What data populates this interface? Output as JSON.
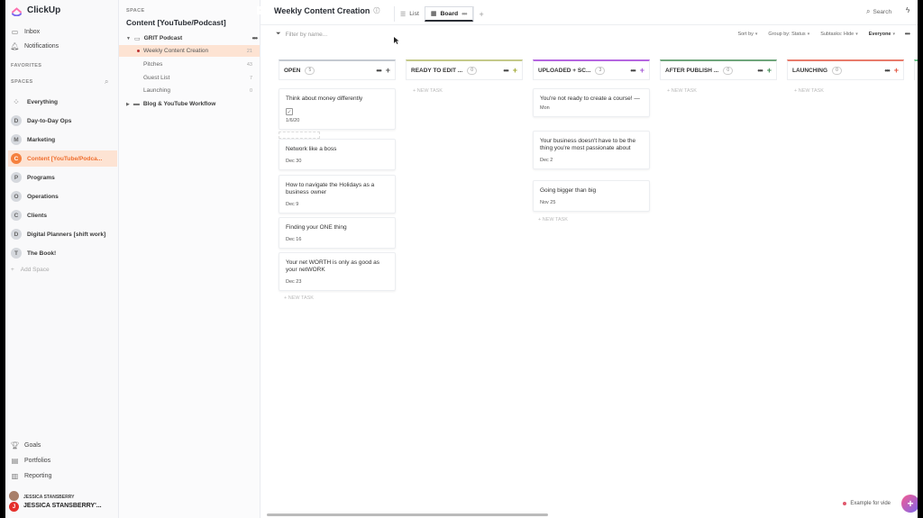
{
  "app": {
    "name": "ClickUp"
  },
  "sidebar": {
    "nav": [
      {
        "label": "Inbox",
        "icon": "inbox-icon"
      },
      {
        "label": "Notifications",
        "icon": "bell-icon"
      }
    ],
    "favorites_label": "FAVORITES",
    "spaces_label": "SPACES",
    "spaces": [
      {
        "letter": "",
        "label": "Everything"
      },
      {
        "letter": "D",
        "label": "Day-to-Day Ops"
      },
      {
        "letter": "M",
        "label": "Marketing"
      },
      {
        "letter": "C",
        "label": "Content [YouTube/Podca...",
        "active": true
      },
      {
        "letter": "P",
        "label": "Programs"
      },
      {
        "letter": "O",
        "label": "Operations"
      },
      {
        "letter": "C",
        "label": "Clients"
      },
      {
        "letter": "D",
        "label": "Digital Planners [shift work]"
      },
      {
        "letter": "T",
        "label": "The Book!"
      }
    ],
    "add_space": "Add Space",
    "bottom": [
      {
        "label": "Goals",
        "icon": "trophy-icon"
      },
      {
        "label": "Portfolios",
        "icon": "portfolio-icon"
      },
      {
        "label": "Reporting",
        "icon": "reporting-icon"
      }
    ],
    "user": {
      "workspace": "JESSICA STANSBERRY",
      "name": "JESSICA STANSBERRY'...",
      "initial": "J"
    }
  },
  "sidebar2": {
    "space_label": "SPACE",
    "title": "Content [YouTube/Podcast]",
    "folder": "GRIT Podcast",
    "lists": [
      {
        "label": "Weekly Content Creation",
        "count": "21",
        "active": true
      },
      {
        "label": "Pitches",
        "count": "43"
      },
      {
        "label": "Guest List",
        "count": "7"
      },
      {
        "label": "Launching",
        "count": "0"
      }
    ],
    "folder2": "Blog & YouTube Workflow"
  },
  "header": {
    "title": "Weekly Content Creation",
    "tabs": [
      {
        "label": "List"
      },
      {
        "label": "Board",
        "active": true
      }
    ],
    "search": "Search"
  },
  "toolbar": {
    "filter_placeholder": "Filter by name...",
    "sort": "Sort by",
    "group": "Group by: Status",
    "subtasks": "Subtasks: Hide",
    "assignee": "Everyone"
  },
  "new_task": "+ NEW TASK",
  "columns": [
    {
      "name": "OPEN",
      "count": "5",
      "color": "#c4c9d1",
      "plus_color": "#555555",
      "cards": [
        {
          "title": "Think about money differently",
          "date": "1/6/20",
          "check": true
        },
        {
          "title": "Network like a boss",
          "date": "Dec 30"
        },
        {
          "title": "How to navigate the Holidays as a business owner",
          "date": "Dec 9"
        },
        {
          "title": "Finding your ONE thing",
          "date": "Dec 16"
        },
        {
          "title": "Your net WORTH is only as good as your netWORK",
          "date": "Dec 23"
        }
      ]
    },
    {
      "name": "READY TO EDIT ...",
      "count": "0",
      "color": "#c4c98a",
      "plus_color": "#a0a832",
      "cards": []
    },
    {
      "name": "UPLOADED + SC...",
      "count": "3",
      "color": "#b566e0",
      "plus_color": "#a55ad6",
      "cards": [
        {
          "title": "You're not ready to create a course! —",
          "date": "Mon"
        },
        {
          "title": "Your business doesn't have to be the thing you're most passionate about",
          "date": "Dec 2"
        },
        {
          "title": "Going bigger than big",
          "date": "Nov 25"
        }
      ]
    },
    {
      "name": "AFTER PUBLISH ...",
      "count": "0",
      "color": "#6fa67c",
      "plus_color": "#3f8a52",
      "cards": []
    },
    {
      "name": "LAUNCHING",
      "count": "0",
      "color": "#e87b6b",
      "plus_color": "#e0533e",
      "cards": []
    }
  ],
  "example_tag": "Example for vide"
}
